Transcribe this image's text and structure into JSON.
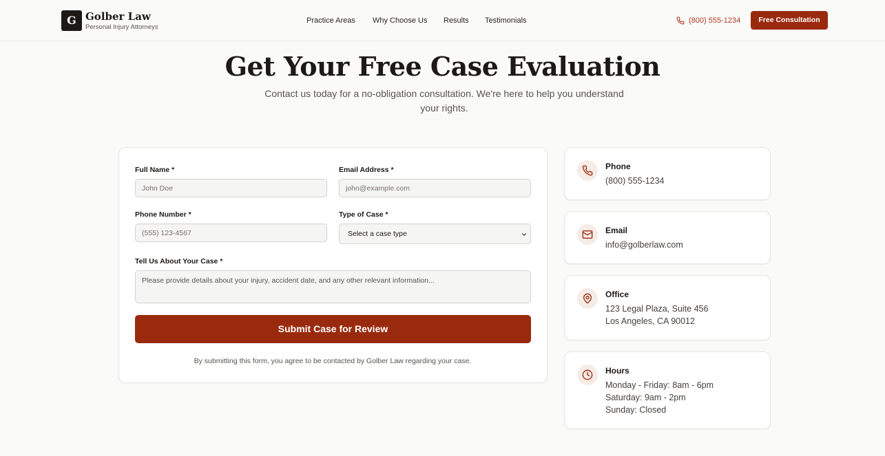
{
  "header": {
    "logo_letter": "G",
    "brand_name": "Golber Law",
    "brand_tagline": "Personal Injury Attorneys",
    "nav": [
      "Practice Areas",
      "Why Choose Us",
      "Results",
      "Testimonials"
    ],
    "phone": "(800) 555-1234",
    "cta_label": "Free Consultation"
  },
  "hero": {
    "title": "Get Your Free Case Evaluation",
    "subtitle": "Contact us today for a no-obligation consultation. We're here to help you understand your rights."
  },
  "form": {
    "full_name_label": "Full Name *",
    "full_name_placeholder": "John Doe",
    "email_label": "Email Address *",
    "email_placeholder": "john@example.com",
    "phone_label": "Phone Number *",
    "phone_placeholder": "(555) 123-4567",
    "case_type_label": "Type of Case *",
    "case_type_selected": "Select a case type",
    "details_label": "Tell Us About Your Case *",
    "details_placeholder": "Please provide details about your injury, accident date, and any other relevant information...",
    "submit_label": "Submit Case for Review",
    "disclaimer": "By submitting this form, you agree to be contacted by Golber Law regarding your case."
  },
  "contact": {
    "phone": {
      "title": "Phone",
      "lines": [
        "(800) 555-1234"
      ],
      "icon": "phone-icon"
    },
    "email": {
      "title": "Email",
      "lines": [
        "info@golberlaw.com"
      ],
      "icon": "mail-icon"
    },
    "office": {
      "title": "Office",
      "lines": [
        "123 Legal Plaza, Suite 456",
        "Los Angeles, CA 90012"
      ],
      "icon": "map-pin-icon"
    },
    "hours": {
      "title": "Hours",
      "lines": [
        "Monday - Friday: 8am - 6pm",
        "Saturday: 9am - 2pm",
        "Sunday: Closed"
      ],
      "icon": "clock-icon"
    }
  },
  "colors": {
    "accent": "#9a2a0e",
    "accent_text": "#b23a1a",
    "background": "#fafaf9",
    "icon_bg": "#f5ebe7"
  }
}
